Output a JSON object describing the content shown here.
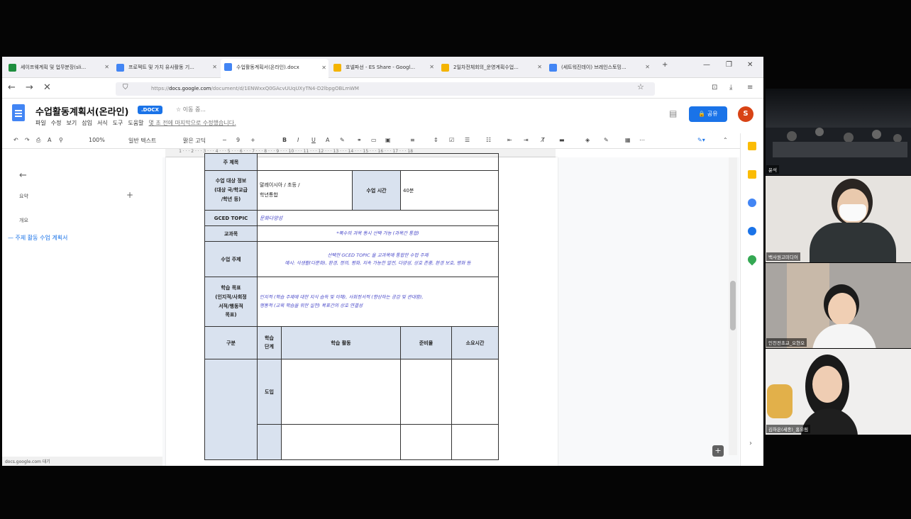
{
  "browser": {
    "tabs": [
      {
        "label": "세이프웨계획 및 업무분장(sli...",
        "color": "#1e8e3e",
        "active": false
      },
      {
        "label": "프로젝트 및 가치 유사활동 기...",
        "color": "#4285f4",
        "active": false
      },
      {
        "label": "수업활동계획서(온라인).docx",
        "color": "#4285f4",
        "active": true
      },
      {
        "label": "호넬파선 - ES Share - Googl...",
        "color": "#f4b400",
        "active": false
      },
      {
        "label": "2일차전체회의_운영계획수업...",
        "color": "#f4b400",
        "active": false
      },
      {
        "label": "(세트워진데이) 브레인스토밍...",
        "color": "#4285f4",
        "active": false
      }
    ],
    "url_prefix": "https://",
    "url_domain": "docs.google.com",
    "url_rest": "/document/d/1ENWxxQ0GAcvUUqUXyTN4-D2lbpgOBLmWM",
    "status": "docs.google.com 대기"
  },
  "docs": {
    "title": "수업활동계획서(온라인)",
    "badge": ".DOCX",
    "starred": "☆ 이동 중...",
    "menus": [
      "파일",
      "수정",
      "보기",
      "삽입",
      "서식",
      "도구",
      "도움말"
    ],
    "last_edit": "몇 초 전에 마지막으로 수정했습니다.",
    "share_label": "🔒 공유",
    "user_initial": "S",
    "toolbar": {
      "zoom": "100%",
      "style": "일반 텍스트",
      "font": "맑은 고딕",
      "size": "9"
    }
  },
  "outline": {
    "header": "요약",
    "label2": "개요",
    "item": "— 주제 활동 수업 계획서"
  },
  "table": {
    "row_title": {
      "label": "주 제목",
      "value": ""
    },
    "row_target": {
      "label": "수업 대상 정보\n(대상 국/학교급\n/학년 등)",
      "value": "말레이시아 / 초등 /\n학년통합",
      "time_label": "수업 시간",
      "time_value": "40분"
    },
    "row_gced": {
      "label": "GCED TOPIC",
      "value": "문화다양성"
    },
    "row_subject": {
      "label": "교과목",
      "hint": "*복수의 과목 동시 선택 가능 (과목간 통합)"
    },
    "row_theme": {
      "label": "수업 주제",
      "hint": "선택한 GCED TOPIC 을 교과목에 통합한 수업 주제\n예시: 식생활(다문화), 환경, 정의, 평화, 지속 가능한 발전, 다양성, 상호 존중, 환경 보호, 평화 등"
    },
    "row_goal": {
      "label": "학습 목표\n(인지적/사회정\n서적/행동적\n목표)",
      "hint": "인지적 (학습 주제에 대한 지식 습득 및 이해), 사회정서적 (향상하는 공감 및 관대함),\n행동적 (교육 학습을 위한 실천) 목표간의 상호 연결성"
    },
    "headers": {
      "gubun": "구분",
      "step": "학습\n단계",
      "activity": "학습 활동",
      "prep": "준비물",
      "time": "소요시간"
    },
    "step_intro": "도입"
  },
  "participants": [
    {
      "name": "윤석"
    },
    {
      "name": "백사원고미디어"
    },
    {
      "name": "인천전초교_오현오"
    },
    {
      "name": "김하은(세종)_홍유림"
    }
  ]
}
